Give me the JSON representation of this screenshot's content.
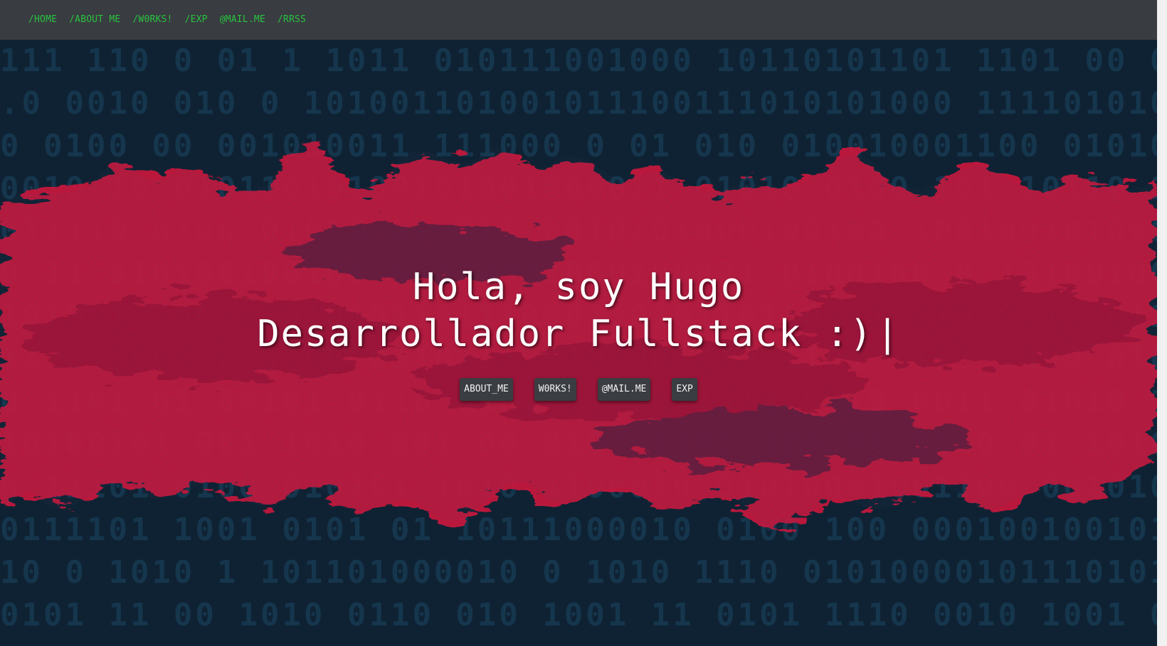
{
  "nav": {
    "items": [
      {
        "label": "/HOME"
      },
      {
        "label": "/ABOUT ME"
      },
      {
        "label": "/W0RKS!"
      },
      {
        "label": "/EXP"
      },
      {
        "label": "@MAIL.ME"
      },
      {
        "label": "/RRSS"
      }
    ]
  },
  "hero": {
    "line1": "Hola, soy Hugo",
    "line2": "Desarrollador Fullstack :)",
    "cursor": "|",
    "buttons": [
      {
        "label": "ABOUT_ME"
      },
      {
        "label": "W0RKS!"
      },
      {
        "label": "@MAIL.ME"
      },
      {
        "label": "EXP"
      }
    ]
  },
  "colors": {
    "nav_bg": "#393c41",
    "nav_link": "#28c33f",
    "hero_bg": "#0f2233",
    "splash": "#c8183c",
    "button_bg": "#3a3d42"
  }
}
